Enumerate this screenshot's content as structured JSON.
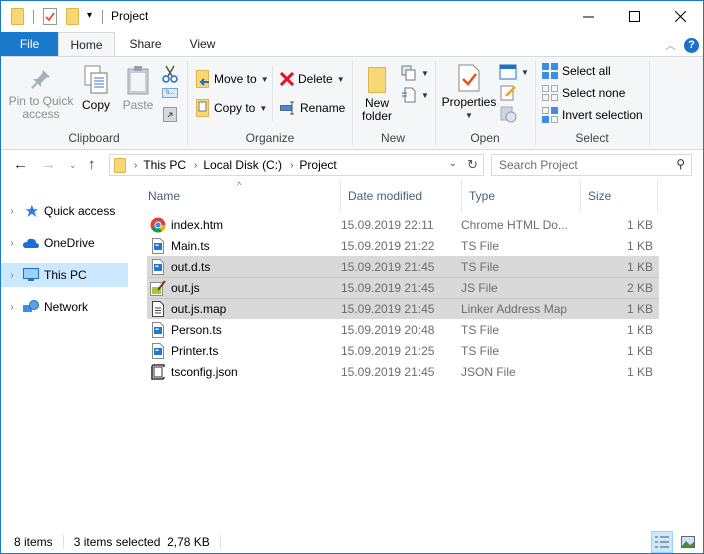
{
  "window": {
    "title": "Project",
    "controls": {
      "minimize": "—",
      "maximize": "☐",
      "close": "✕"
    }
  },
  "quick_access_toolbar": {
    "items": [
      "folder-icon",
      "properties-icon",
      "new-folder-icon",
      "customize-dropdown"
    ]
  },
  "ribbon_tabs": [
    {
      "label": "File",
      "active": false
    },
    {
      "label": "Home",
      "active": true
    },
    {
      "label": "Share",
      "active": false
    },
    {
      "label": "View",
      "active": false
    }
  ],
  "ribbon": {
    "clipboard": {
      "label": "Clipboard",
      "pin": "Pin to Quick",
      "pin2": "access",
      "copy": "Copy",
      "paste": "Paste"
    },
    "organize": {
      "label": "Organize",
      "move_to": "Move to",
      "copy_to": "Copy to",
      "delete": "Delete",
      "rename": "Rename"
    },
    "new": {
      "label": "New",
      "new_folder_1": "New",
      "new_folder_2": "folder"
    },
    "open": {
      "label": "Open",
      "properties": "Properties"
    },
    "select": {
      "label": "Select",
      "select_all": "Select all",
      "select_none": "Select none",
      "invert_selection": "Invert selection"
    }
  },
  "address": {
    "breadcrumbs": [
      "This PC",
      "Local Disk (C:)",
      "Project"
    ],
    "search_placeholder": "Search Project"
  },
  "nav_pane": [
    {
      "label": "Quick access",
      "icon": "star-icon",
      "selected": false
    },
    {
      "label": "OneDrive",
      "icon": "cloud-icon",
      "selected": false
    },
    {
      "label": "This PC",
      "icon": "computer-icon",
      "selected": true
    },
    {
      "label": "Network",
      "icon": "network-icon",
      "selected": false
    }
  ],
  "columns": {
    "name": "Name",
    "date": "Date modified",
    "type": "Type",
    "size": "Size"
  },
  "files": [
    {
      "name": "index.htm",
      "date": "15.09.2019 22:11",
      "type": "Chrome HTML Do...",
      "size": "1 KB",
      "icon": "chrome-icon",
      "selected": false
    },
    {
      "name": "Main.ts",
      "date": "15.09.2019 21:22",
      "type": "TS File",
      "size": "1 KB",
      "icon": "ts-file-icon",
      "selected": false
    },
    {
      "name": "out.d.ts",
      "date": "15.09.2019 21:45",
      "type": "TS File",
      "size": "1 KB",
      "icon": "ts-file-icon",
      "selected": true
    },
    {
      "name": "out.js",
      "date": "15.09.2019 21:45",
      "type": "JS File",
      "size": "2 KB",
      "icon": "js-file-icon",
      "selected": true
    },
    {
      "name": "out.js.map",
      "date": "15.09.2019 21:45",
      "type": "Linker Address Map",
      "size": "1 KB",
      "icon": "map-file-icon",
      "selected": true
    },
    {
      "name": "Person.ts",
      "date": "15.09.2019 20:48",
      "type": "TS File",
      "size": "1 KB",
      "icon": "ts-file-icon",
      "selected": false
    },
    {
      "name": "Printer.ts",
      "date": "15.09.2019 21:25",
      "type": "TS File",
      "size": "1 KB",
      "icon": "ts-file-icon",
      "selected": false
    },
    {
      "name": "tsconfig.json",
      "date": "15.09.2019 21:45",
      "type": "JSON File",
      "size": "1 KB",
      "icon": "json-file-icon",
      "selected": false
    }
  ],
  "status": {
    "item_count": "8 items",
    "selection": "3 items selected  2,78 KB"
  },
  "colors": {
    "accent": "#1979ca",
    "selection": "#d9d9d9",
    "nav_selected": "#cce8ff"
  }
}
